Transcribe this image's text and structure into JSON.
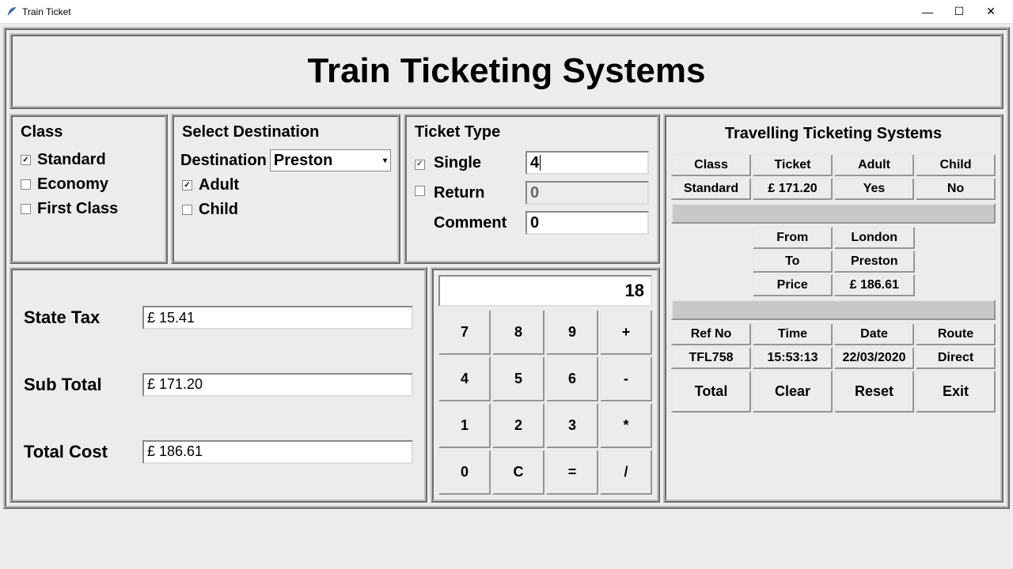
{
  "window": {
    "title": "Train Ticket"
  },
  "banner": {
    "heading": "Train Ticketing Systems"
  },
  "class_panel": {
    "title": "Class",
    "options": {
      "standard": {
        "label": "Standard",
        "checked": true
      },
      "economy": {
        "label": "Economy",
        "checked": false
      },
      "first": {
        "label": "First Class",
        "checked": false
      }
    }
  },
  "dest_panel": {
    "title": "Select Destination",
    "dest_label": "Destination",
    "dest_value": "Preston",
    "adult": {
      "label": "Adult",
      "checked": true
    },
    "child": {
      "label": "Child",
      "checked": false
    }
  },
  "ticket_panel": {
    "title": "Ticket Type",
    "single": {
      "label": "Single",
      "checked": true,
      "value": "4"
    },
    "ret": {
      "label": "Return",
      "checked": false,
      "value": "0"
    },
    "comment": {
      "label": "Comment",
      "value": "0"
    }
  },
  "totals": {
    "state_tax": {
      "label": "State Tax",
      "value": "£ 15.41"
    },
    "sub_total": {
      "label": "Sub Total",
      "value": "£ 171.20"
    },
    "total_cost": {
      "label": "Total Cost",
      "value": "£ 186.61"
    }
  },
  "calc": {
    "display": "18",
    "keys": [
      "7",
      "8",
      "9",
      "+",
      "4",
      "5",
      "6",
      "-",
      "1",
      "2",
      "3",
      "*",
      "0",
      "C",
      "=",
      "/"
    ]
  },
  "receipt": {
    "title": "Travelling Ticketing Systems",
    "row1_headers": [
      "Class",
      "Ticket",
      "Adult",
      "Child"
    ],
    "row1_values": [
      "Standard",
      "£ 171.20",
      "Yes",
      "No"
    ],
    "route": {
      "from_label": "From",
      "from_value": "London",
      "to_label": "To",
      "to_value": "Preston",
      "price_label": "Price",
      "price_value": "£ 186.61"
    },
    "row3_headers": [
      "Ref No",
      "Time",
      "Date",
      "Route"
    ],
    "row3_values": [
      "TFL758",
      "15:53:13",
      "22/03/2020",
      "Direct"
    ],
    "actions": {
      "total": "Total",
      "clear": "Clear",
      "reset": "Reset",
      "exit": "Exit"
    }
  }
}
